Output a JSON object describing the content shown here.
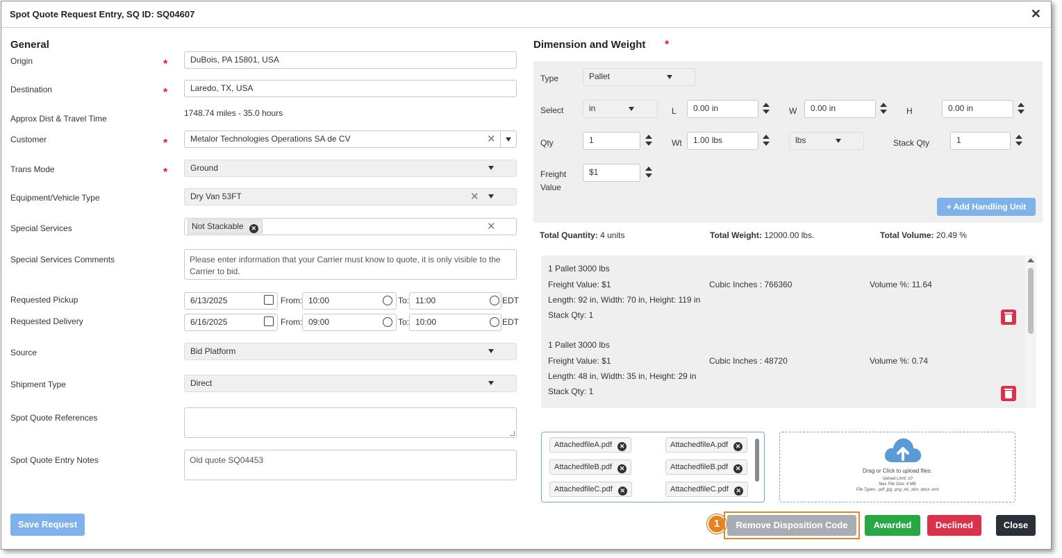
{
  "dialog": {
    "title": "Spot Quote Request Entry, SQ ID: SQ04607",
    "close_glyph": "✕"
  },
  "general": {
    "heading": "General",
    "origin": {
      "label": "Origin",
      "value": "DuBois, PA 15801, USA"
    },
    "destination": {
      "label": "Destination",
      "value": "Laredo, TX, USA"
    },
    "dist": {
      "label": "Approx Dist & Travel Time",
      "value": "1748.74 miles - 35.0 hours"
    },
    "customer": {
      "label": "Customer",
      "value": "Metalor Technologies Operations SA de CV"
    },
    "trans_mode": {
      "label": "Trans Mode",
      "value": "Ground"
    },
    "equipment": {
      "label": "Equipment/Vehicle Type",
      "value": "Dry Van 53FT"
    },
    "special_services": {
      "label": "Special Services",
      "tag": "Not Stackable"
    },
    "comments": {
      "label": "Special Services Comments",
      "placeholder": "Please enter information that your Carrier must know to quote, it is only visible to the Carrier to bid."
    },
    "pickup": {
      "label": "Requested Pickup",
      "date": "6/13/2025",
      "from_label": "From:",
      "from": "10:00",
      "to_label": "To:",
      "to": "11:00",
      "tz": "EDT"
    },
    "delivery": {
      "label": "Requested Delivery",
      "date": "6/16/2025",
      "from_label": "From:",
      "from": "09:00",
      "to_label": "To:",
      "to": "10:00",
      "tz": "EDT"
    },
    "source": {
      "label": "Source",
      "value": "Bid Platform"
    },
    "shipment_type": {
      "label": "Shipment Type",
      "value": "Direct"
    },
    "references": {
      "label": "Spot Quote References",
      "value": ""
    },
    "notes": {
      "label": "Spot Quote Entry Notes",
      "value": "Old quote SQ04453"
    },
    "required_mark": "*"
  },
  "dimension": {
    "heading": "Dimension and Weight",
    "type_label": "Type",
    "type_value": "Pallet",
    "select_label": "Select",
    "select_value": "in",
    "l_label": "L",
    "l_value": "0.00 in",
    "w_label": "W",
    "w_value": "0.00 in",
    "h_label": "H",
    "h_value": "0.00 in",
    "qty_label": "Qty",
    "qty_value": "1",
    "wt_label": "Wt",
    "wt_value": "1.00 lbs",
    "unit_value": "lbs",
    "stack_label": "Stack Qty",
    "stack_value": "1",
    "freight_label_1": "Freight",
    "freight_label_2": "Value",
    "freight_value": "$1",
    "add_button": "+ Add Handling Unit"
  },
  "totals": {
    "quantity_label": "Total Quantity:",
    "quantity": "4 units",
    "weight_label": "Total Weight:",
    "weight": "12000.00 lbs.",
    "volume_label": "Total Volume:",
    "volume": "20.49 %"
  },
  "units": [
    {
      "title": "1 Pallet 3000 lbs",
      "freight": "Freight Value: $1",
      "cubic": "Cubic Inches : 766360",
      "volume": "Volume %: 11.64",
      "dims": "Length: 92 in, Width: 70 in, Height: 119 in",
      "stack": "Stack Qty: 1"
    },
    {
      "title": "1 Pallet 3000 lbs",
      "freight": "Freight Value: $1",
      "cubic": "Cubic Inches : 48720",
      "volume": "Volume %: 0.74",
      "dims": "Length: 48 in, Width: 35 in, Height: 29 in",
      "stack": "Stack Qty: 1"
    }
  ],
  "attachments": {
    "col1": [
      "AttachedfileA.pdf",
      "AttachedfileB.pdf",
      "AttachedfileC.pdf"
    ],
    "col2": [
      "AttachedfileA.pdf",
      "AttachedfileB.pdf",
      "AttachedfileC.pdf"
    ]
  },
  "upload": {
    "line1": "Drag or Click to upload files.",
    "line2": "Upload Limit: 10",
    "line3": "Max File Size: 4 MB",
    "line4": "File Types: .pdf .jpg .png .xls .xlsx .docx .eml"
  },
  "footer": {
    "save": "Save Request",
    "callout": "1",
    "remove": "Remove Disposition Code",
    "awarded": "Awarded",
    "declined": "Declined",
    "close": "Close"
  },
  "colors": {
    "awarded": "#28a745",
    "declined": "#d9324a",
    "close": "#2b3038",
    "save": "#7fb1ea",
    "callout": "#e8821e"
  }
}
